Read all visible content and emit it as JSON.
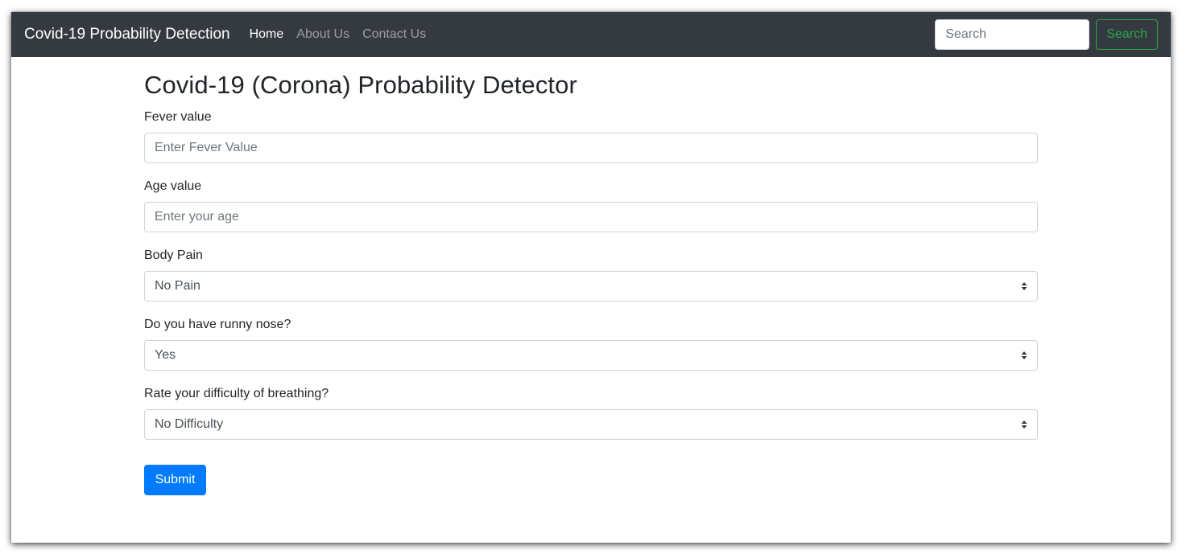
{
  "navbar": {
    "brand": "Covid-19 Probability Detection",
    "links": [
      {
        "label": "Home"
      },
      {
        "label": "About Us"
      },
      {
        "label": "Contact Us"
      }
    ],
    "search": {
      "placeholder": "Search",
      "button_label": "Search"
    }
  },
  "main": {
    "title": "Covid-19 (Corona) Probability Detector",
    "fever": {
      "label": "Fever value",
      "placeholder": "Enter Fever Value"
    },
    "age": {
      "label": "Age value",
      "placeholder": "Enter your age"
    },
    "body_pain": {
      "label": "Body Pain",
      "selected": "No Pain"
    },
    "runny_nose": {
      "label": "Do you have runny nose?",
      "selected": "Yes"
    },
    "breathing": {
      "label": "Rate your difficulty of breathing?",
      "selected": "No Difficulty"
    },
    "submit_label": "Submit"
  },
  "colors": {
    "navbar_bg": "#343a40",
    "primary": "#007bff",
    "success": "#28a745"
  },
  "icons": {
    "select_caret": "sort-caret-icon"
  }
}
